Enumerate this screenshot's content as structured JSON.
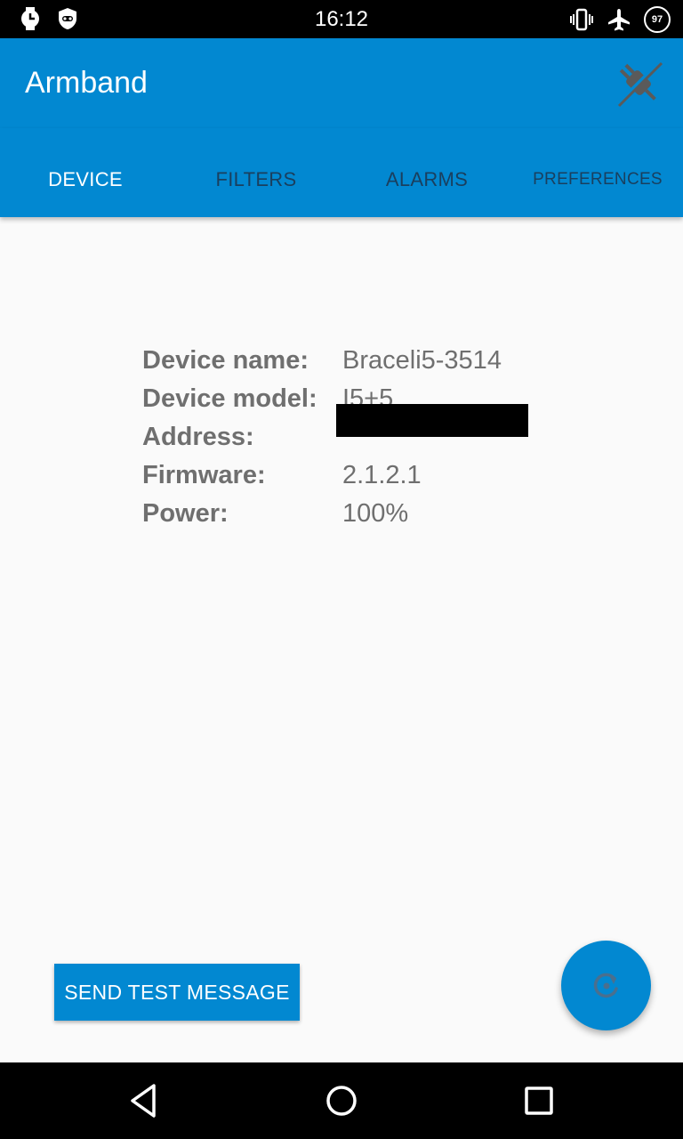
{
  "status_bar": {
    "time": "16:12",
    "battery_level": "97",
    "left_icons": [
      "watch-icon",
      "shield-face-icon"
    ],
    "right_icons": [
      "vibrate-icon",
      "airplane-icon",
      "battery-icon"
    ]
  },
  "app_bar": {
    "title": "Armband",
    "action_icon": "plug-disconnected-icon"
  },
  "tabs": [
    {
      "label": "DEVICE",
      "active": true
    },
    {
      "label": "FILTERS",
      "active": false
    },
    {
      "label": "ALARMS",
      "active": false
    },
    {
      "label": "PREFERENCES",
      "active": false
    }
  ],
  "device_info": {
    "name_label": "Device name:",
    "name_value": "Braceli5-3514",
    "model_label": "Device model:",
    "model_value": "I5+5",
    "address_label": "Address:",
    "address_value": "",
    "firmware_label": "Firmware:",
    "firmware_value": "2.1.2.1",
    "power_label": "Power:",
    "power_value": "100%"
  },
  "actions": {
    "send_test_label": "SEND TEST MESSAGE",
    "fab_icon": "refresh-icon"
  },
  "nav_bar": {
    "icons": [
      "back-icon",
      "home-icon",
      "recents-icon"
    ]
  },
  "colors": {
    "primary": "#0288d1",
    "tab_inactive": "#1a3f5e",
    "text_gray": "#6f6f6f",
    "background": "#fafafa"
  }
}
